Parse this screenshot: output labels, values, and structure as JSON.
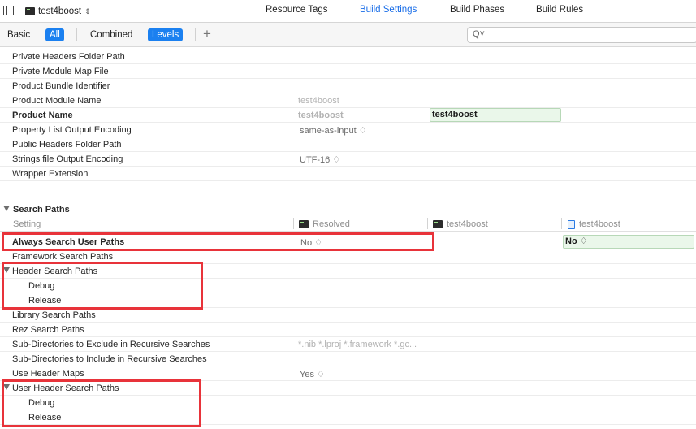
{
  "toolbar": {
    "target_name": "test4boost",
    "tabs": [
      "Resource Tags",
      "Build Settings",
      "Build Phases",
      "Build Rules"
    ],
    "active_tab": "Build Settings"
  },
  "filter": {
    "basic": "Basic",
    "all": "All",
    "combined": "Combined",
    "levels": "Levels",
    "plus": "+",
    "search_placeholder": "",
    "search_icon": "Q˅"
  },
  "packaging_rows": [
    {
      "label": "Private Headers Folder Path",
      "resolved": "",
      "target": ""
    },
    {
      "label": "Private Module Map File",
      "resolved": "",
      "target": ""
    },
    {
      "label": "Product Bundle Identifier",
      "resolved": "",
      "target": ""
    },
    {
      "label": "Product Module Name",
      "resolved": "test4boost",
      "target": ""
    },
    {
      "label": "Product Name",
      "resolved": "test4boost",
      "target": "test4boost"
    },
    {
      "label": "Property List Output Encoding",
      "resolved": "same-as-input ♢",
      "target": ""
    },
    {
      "label": "Public Headers Folder Path",
      "resolved": "",
      "target": ""
    },
    {
      "label": "Strings file Output Encoding",
      "resolved": "UTF-16 ♢",
      "target": ""
    },
    {
      "label": "Wrapper Extension",
      "resolved": "",
      "target": ""
    }
  ],
  "search_paths": {
    "title": "Search Paths",
    "columns": {
      "setting": "Setting",
      "resolved": "Resolved",
      "target": "test4boost",
      "project": "test4boost"
    },
    "rows": [
      {
        "label": "Always Search User Paths",
        "resolved": "No ♢",
        "project": "No ♢"
      },
      {
        "label": "Framework Search Paths",
        "resolved": ""
      },
      {
        "label": "Header Search Paths",
        "resolved": ""
      },
      {
        "label": "Debug",
        "resolved": ""
      },
      {
        "label": "Release",
        "resolved": ""
      },
      {
        "label": "Library Search Paths",
        "resolved": ""
      },
      {
        "label": "Rez Search Paths",
        "resolved": ""
      },
      {
        "label": "Sub-Directories to Exclude in Recursive Searches",
        "resolved": "*.nib *.lproj *.framework *.gc..."
      },
      {
        "label": "Sub-Directories to Include in Recursive Searches",
        "resolved": ""
      },
      {
        "label": "Use Header Maps",
        "resolved": "Yes ♢"
      },
      {
        "label": "User Header Search Paths",
        "resolved": ""
      },
      {
        "label": "Debug",
        "resolved": ""
      },
      {
        "label": "Release",
        "resolved": ""
      }
    ]
  },
  "colors": {
    "accent": "#1b80f0",
    "highlight_box": "#e8333a",
    "set_value_bg": "#eaf7ea"
  }
}
